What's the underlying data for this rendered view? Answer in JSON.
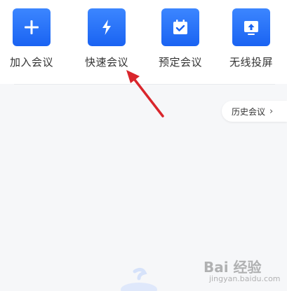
{
  "actions": [
    {
      "id": "join",
      "label": "加入会议",
      "icon": "plus-icon"
    },
    {
      "id": "quick",
      "label": "快速会议",
      "icon": "lightning-icon"
    },
    {
      "id": "schedule",
      "label": "预定会议",
      "icon": "calendar-check-icon"
    },
    {
      "id": "cast",
      "label": "无线投屏",
      "icon": "screen-cast-icon"
    }
  ],
  "history_button": {
    "label": "历史会议",
    "chevron": "›"
  },
  "watermark": {
    "logo": "Bai 经验",
    "sub": "jingyan.baidu.com"
  },
  "colors": {
    "tile_blue": "#1a63f2",
    "annotation_arrow": "#d9262c",
    "background": "#f6f7f9"
  }
}
